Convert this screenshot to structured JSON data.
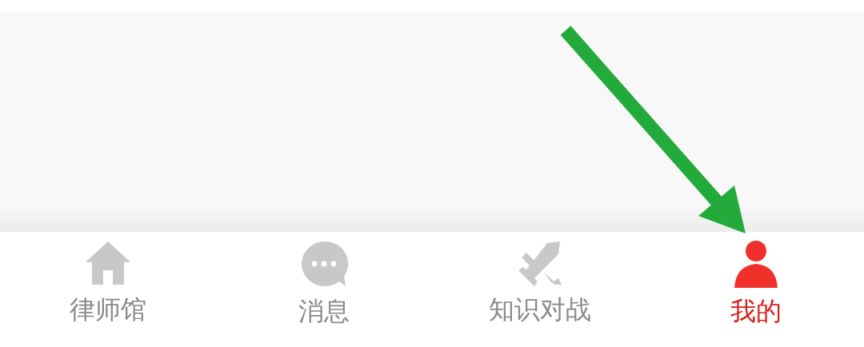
{
  "tabs": [
    {
      "label": "律师馆",
      "kind": "house",
      "selected": false
    },
    {
      "label": "消息",
      "kind": "chat",
      "selected": false
    },
    {
      "label": "知识对战",
      "kind": "swords",
      "selected": false
    },
    {
      "label": "我的",
      "kind": "person",
      "selected": true
    }
  ],
  "annotation": {
    "kind": "arrow",
    "color": "#22aa3a"
  }
}
